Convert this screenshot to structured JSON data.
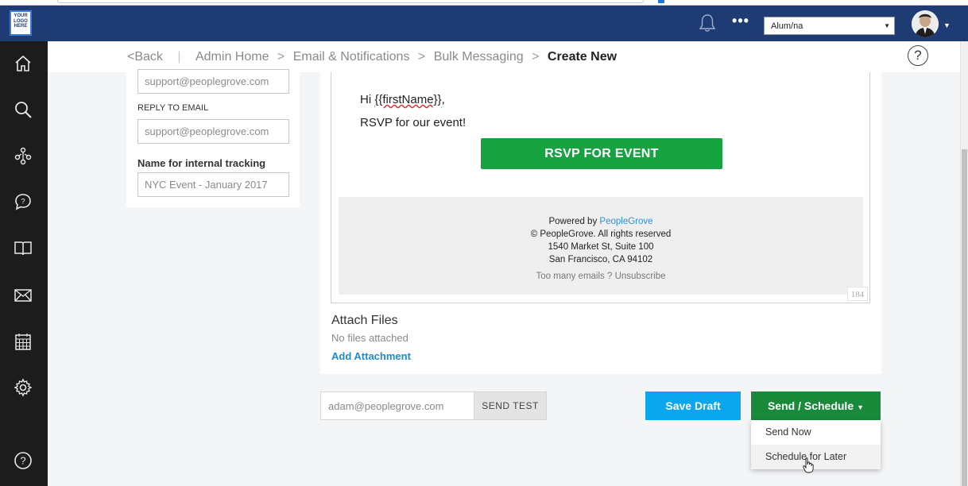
{
  "topbar": {
    "logo_text": "YOUR LOGO HERE",
    "role_select": "Alum/na"
  },
  "breadcrumb": {
    "back": "Back",
    "items": [
      "Admin Home",
      "Email & Notifications",
      "Bulk Messaging"
    ],
    "current": "Create New"
  },
  "help_label": "?",
  "settings": {
    "from_email_value": "support@peoplegrove.com",
    "reply_to_label": "REPLY TO EMAIL",
    "reply_to_value": "support@peoplegrove.com",
    "tracking_label": "Name for internal tracking",
    "tracking_placeholder": "NYC Event - January 2017"
  },
  "email_body": {
    "greeting_prefix": "Hi ",
    "greeting_var": "{{firstName}}",
    "greeting_suffix": ",",
    "line": "RSVP for our event!",
    "button": "RSVP FOR EVENT",
    "footer": {
      "powered_prefix": "Powered by ",
      "powered_link": "PeopleGrove",
      "copyright": "© PeopleGrove. All rights reserved",
      "address1": "1540 Market St, Suite 100",
      "address2": "San Francisco, CA 94102",
      "unsub_prefix": "Too many emails ? ",
      "unsub_link": "Unsubscribe"
    },
    "char_count": "184"
  },
  "attachments": {
    "title": "Attach Files",
    "status": "No files attached",
    "add": "Add Attachment"
  },
  "actions": {
    "test_email_placeholder": "adam@peoplegrove.com",
    "send_test": "SEND TEST",
    "save_draft": "Save Draft",
    "send_schedule": "Send / Schedule",
    "menu": [
      "Send Now",
      "Schedule for Later"
    ]
  },
  "colors": {
    "navbar": "#1f3b73",
    "sidebar": "#1c1c1c",
    "rsvp_green": "#18a343",
    "send_green": "#188a3a",
    "save_blue": "#0aa7ee",
    "link_blue": "#1c8ad1"
  },
  "icons": [
    "home-icon",
    "search-icon",
    "network-icon",
    "chat-icon",
    "book-icon",
    "mail-icon",
    "calendar-icon",
    "settings-icon",
    "help-icon"
  ]
}
